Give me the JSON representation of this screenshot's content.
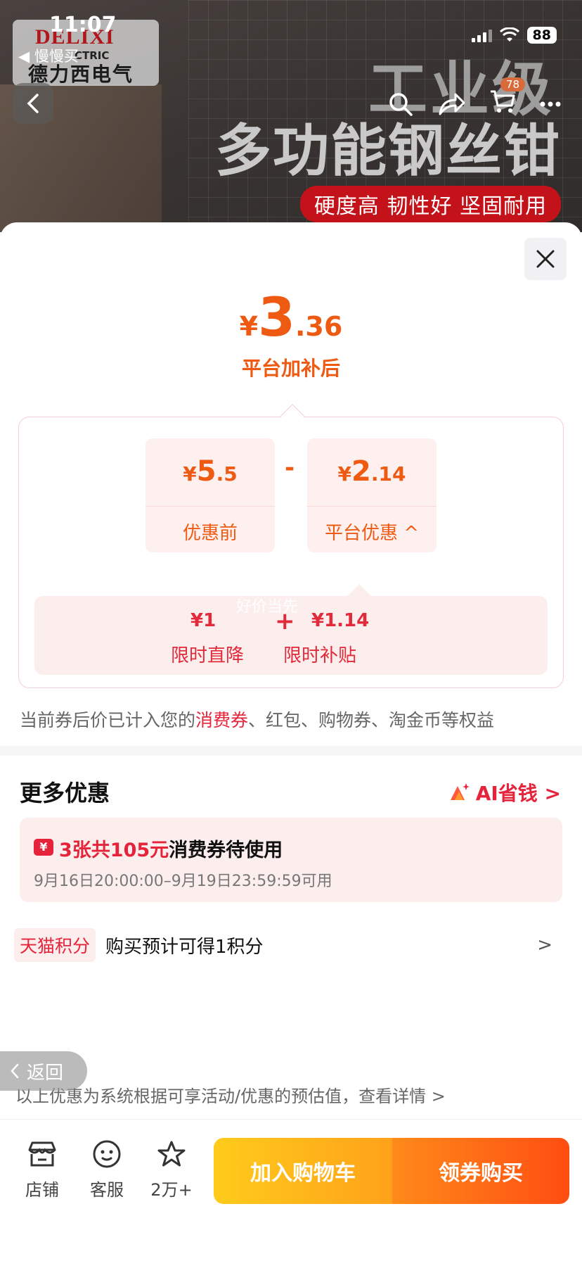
{
  "status_bar": {
    "time": "11:07",
    "back_app": "◀ 慢慢买",
    "battery": "88"
  },
  "banner": {
    "brand_en": "DELIXI",
    "brand_en_sub": "CTRIC",
    "brand_cn": "德力西电气",
    "title_line1": "工业级",
    "title_line2": "多功能钢丝钳",
    "tagline": "硬度高 韧性好 坚固耐用",
    "cart_count": "78"
  },
  "sheet": {
    "final_price": {
      "yen": "¥",
      "int": "3",
      "dec": ".36"
    },
    "final_label": "平台加补后",
    "before": {
      "yen": "¥",
      "int": "5",
      "dec": ".5",
      "label": "优惠前"
    },
    "minus": "-",
    "discount": {
      "yen": "¥",
      "int": "2",
      "dec": ".14",
      "label": "平台优惠 ^"
    },
    "watermark": "好价当先",
    "detail": {
      "item1_value": "¥1",
      "item1_label": "限时直降",
      "plus": "+",
      "item2_value": "¥1.14",
      "item2_label": "限时补贴"
    },
    "note_prefix": "当前券后价已计入您的",
    "note_highlight": "消费券",
    "note_suffix": "、红包、购物券、淘金币等权益",
    "more_title": "更多优惠",
    "ai_link": "AI省钱 >",
    "coupon": {
      "icon": "¥",
      "count_text": "3张共105元",
      "main_text": "消费券待使用",
      "validity": "9月16日20:00:00–9月19日23:59:59可用"
    },
    "points": {
      "tag": "天猫积分",
      "text": "购买预计可得1积分",
      "chevron": ">"
    },
    "float_back": "返回",
    "disclaimer": "以上优惠为系统根据可享活动/优惠的预估值，查看详情 >"
  },
  "bottom_bar": {
    "store": "店铺",
    "service": "客服",
    "favorites": "2万+",
    "add_cart": "加入购物车",
    "buy": "领券购买"
  },
  "colors": {
    "accent_orange": "#ee5a12",
    "accent_red": "#e5243b",
    "brand_red": "#b0161b"
  }
}
